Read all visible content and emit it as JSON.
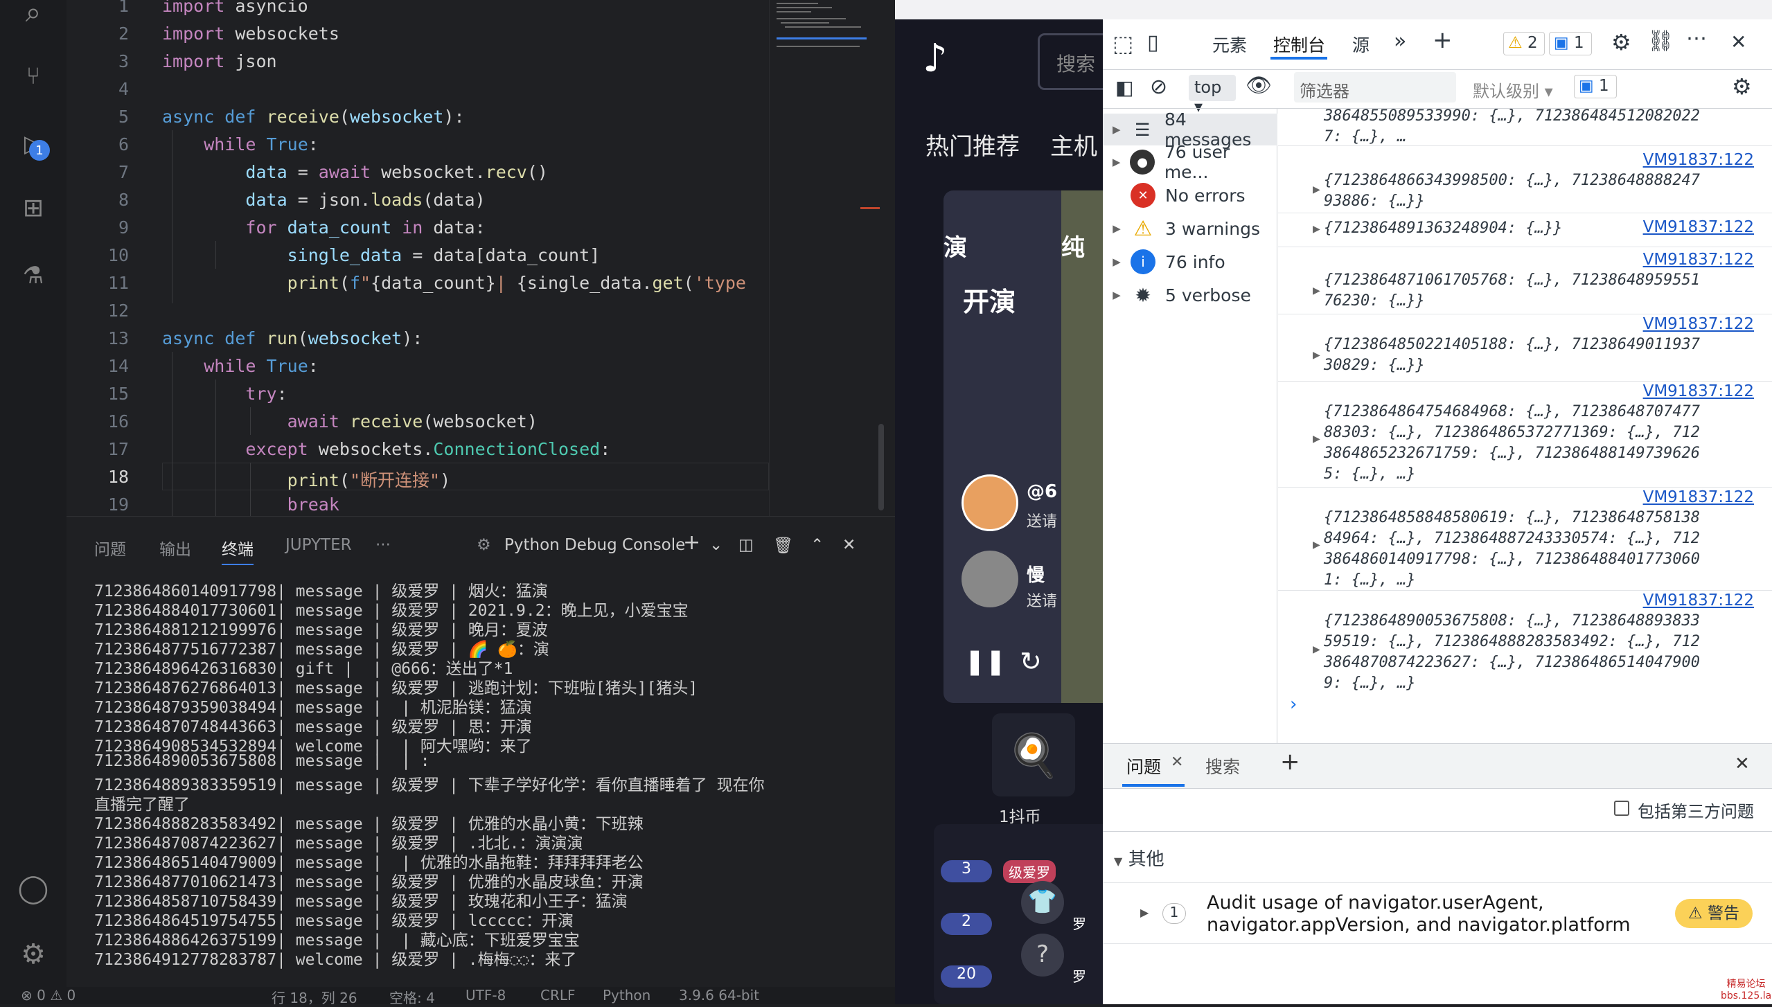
{
  "editor": {
    "lines": [
      "1",
      "2",
      "3",
      "4",
      "5",
      "6",
      "7",
      "8",
      "9",
      "10",
      "11",
      "12",
      "13",
      "14",
      "15",
      "16",
      "17",
      "18",
      "19"
    ]
  },
  "terminal": {
    "tabs": {
      "problems": "问题",
      "output": "输出",
      "terminal": "终端",
      "jupyter": "JUPYTER",
      "more": "···"
    },
    "console_name": "Python Debug Console",
    "lines": [
      "7123864860140917798| message | 级爱罗 | 烟火：猛演",
      "7123864884017730601| message | 级爱罗 | 2021.9.2：晚上见，小爱宝宝",
      "7123864881212199976| message | 级爱罗 | 晚月：夏波",
      "7123864877516772387| message | 级爱罗 | 🌈 🍊：演",
      "7123864896426316830| gift |  | @666：送出了*1",
      "7123864876276864013| message | 级爱罗 | 逃跑计划：下班啦[猪头][猪头]",
      "7123864879359038494| message |  | 机泥胎镁：猛演",
      "7123864870748443663| message | 级爱罗 | 思：开演",
      "7123864908534532894| welcome |  | 阿大嘿哟：来了",
      "7123864890053675808| message |  | :",
      "7123864889383359519| message | 级爱罗 | 下辈子学好化学：看你直播睡着了 现在你",
      "直播完了醒了",
      "7123864888283583492| message | 级爱罗 | 优雅的水晶小黄：下班辣",
      "7123864870874223627| message | 级爱罗 | .北北.：演演演",
      "7123864865140479009| message |  | 优雅的水晶拖鞋：拜拜拜拜老公",
      "7123864877010621473| message | 级爱罗 | 优雅的水晶皮球鱼：开演",
      "7123864858710758439| message | 级爱罗 | 玫瑰花和小王子：猛演",
      "7123864864519754755| message | 级爱罗 | lccccc：开演",
      "7123864886426375199| message |  | 藏心底：下班爱罗宝宝",
      "7123864912778283787| welcome | 级爱罗 | .梅梅◌◌：来了"
    ]
  },
  "statusbar": {
    "errors": "⊗ 0 ⚠ 0",
    "position": "行 18，列 26",
    "spaces": "空格: 4",
    "encoding": "UTF-8",
    "eol": "CRLF",
    "lang": "Python",
    "version": "3.9.6 64-bit"
  },
  "web": {
    "search_placeholder": "搜索",
    "nav_recommend": "热门推荐",
    "nav_host": "主机",
    "video_text1": "开演",
    "video_text2": "演",
    "video_text3": "纯",
    "user1": "@6",
    "user1_sub": "送请",
    "user2": "慢",
    "user2_sub": "送请",
    "gift_label": "1抖币",
    "ranks": [
      {
        "level": "3",
        "name": "级爱罗"
      },
      {
        "level": "2",
        "name": "罗"
      },
      {
        "level": "20",
        "name": "罗"
      }
    ]
  },
  "devtools": {
    "tabs": {
      "elements": "元素",
      "console": "控制台",
      "sources": "源"
    },
    "warn_count": "2",
    "info_count": "1",
    "context": "top",
    "filter_placeholder": "筛选器",
    "level": "默认级别",
    "issues_count": "1",
    "sidebar": [
      {
        "label": "84 messages",
        "icon": "list-icon"
      },
      {
        "label": "76 user me...",
        "icon": "user-icon"
      },
      {
        "label": "No errors",
        "icon": "error-icon"
      },
      {
        "label": "3 warnings",
        "icon": "warning-icon"
      },
      {
        "label": "76 info",
        "icon": "info-icon"
      },
      {
        "label": "5 verbose",
        "icon": "bug-icon"
      }
    ],
    "messages": [
      {
        "source": "",
        "text": "38648550895339​90: {…}, 71238648451208202​2\n7: {…}, …"
      },
      {
        "source": "VM91837:122",
        "text": "{7123864866343998500: {…}, 71238648888247\n93886: {…}}"
      },
      {
        "source": "VM91837:122",
        "text": "{7123864891363248904: {…}}"
      },
      {
        "source": "VM91837:122",
        "text": "{7123864871061705768: {…}, 71238648959551\n76230: {…}}"
      },
      {
        "source": "VM91837:122",
        "text": "{7123864850221405188: {…}, 71238649011937\n30829: {…}}"
      },
      {
        "source": "VM91837:122",
        "text": "{7123864864754684968: {…}, 71238648707477\n88303: {…}, 7123864865372771369: {…}, 712\n3864865232671759: {…}, 71238648814973962​6\n5: {…}, …}"
      },
      {
        "source": "VM91837:122",
        "text": "{7123864858848580619: {…}, 71238648758138\n84964: {…}, 7123864887243330574: {…}, 712\n3864860140917798: {…}, 71238648840177306​0\n1: {…}, …}"
      },
      {
        "source": "VM91837:122",
        "text": "{7123864890053675808: {…}, 71238648893833\n59519: {…}, 7123864888283583492: {…}, 712\n3864870874223627: {…}, 71238648651404790​0\n9: {…}, …}"
      }
    ],
    "drawer": {
      "issues_tab": "问题",
      "search_tab": "搜索",
      "third_party": "包括第三方问题",
      "group": "其他",
      "issue_count": "1",
      "issue_text_1": "Audit usage of navigator.userAgent,",
      "issue_text_2": "navigator.appVersion, and navigator.platform",
      "issue_badge": "⚠ 警告"
    },
    "watermark_1": "精易论坛",
    "watermark_2": "bbs.125.la"
  }
}
